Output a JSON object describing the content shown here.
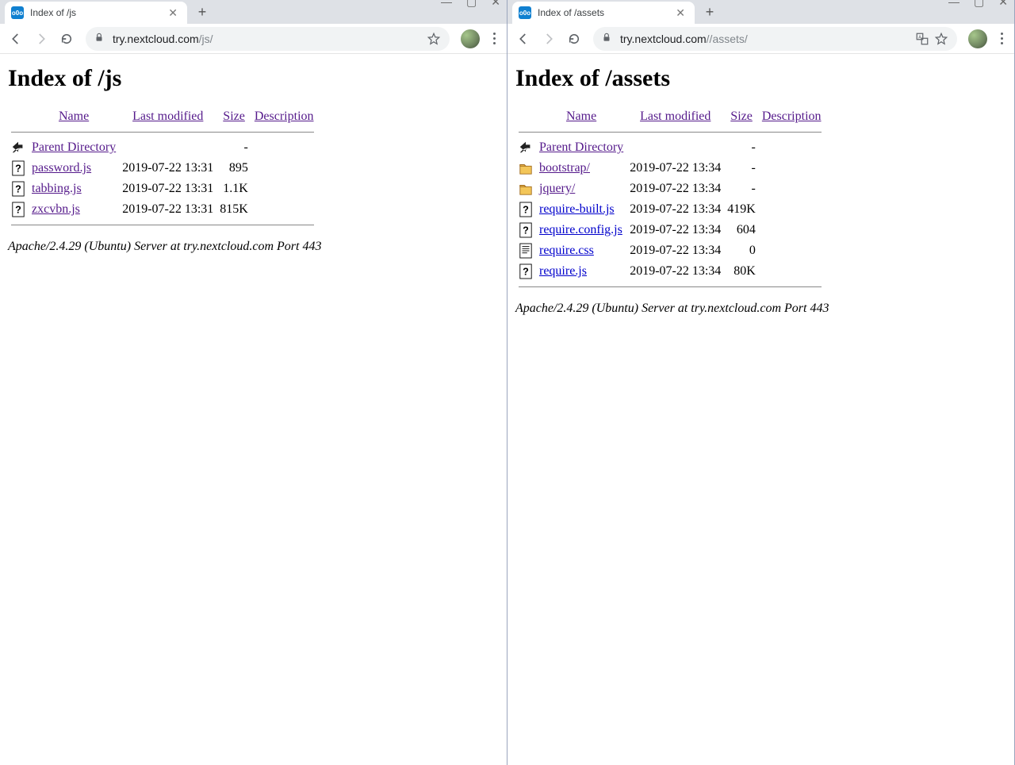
{
  "left": {
    "tab_title": "Index of /js",
    "url_host": "try.nextcloud.com",
    "url_path": "/js/",
    "heading": "Index of /js",
    "columns": {
      "name": "Name",
      "modified": "Last modified",
      "size": "Size",
      "desc": "Description"
    },
    "parent_label": "Parent Directory",
    "rows": [
      {
        "icon": "unknown",
        "name": "password.js",
        "modified": "2019-07-22 13:31",
        "size": "895",
        "visited": true
      },
      {
        "icon": "unknown",
        "name": "tabbing.js",
        "modified": "2019-07-22 13:31",
        "size": "1.1K",
        "visited": true
      },
      {
        "icon": "unknown",
        "name": "zxcvbn.js",
        "modified": "2019-07-22 13:31",
        "size": "815K",
        "visited": true
      }
    ],
    "footer": "Apache/2.4.29 (Ubuntu) Server at try.nextcloud.com Port 443"
  },
  "right": {
    "tab_title": "Index of /assets",
    "url_host": "try.nextcloud.com",
    "url_path": "//assets/",
    "heading": "Index of /assets",
    "columns": {
      "name": "Name",
      "modified": "Last modified",
      "size": "Size",
      "desc": "Description"
    },
    "parent_label": "Parent Directory",
    "rows": [
      {
        "icon": "folder",
        "name": "bootstrap/",
        "modified": "2019-07-22 13:34",
        "size": "-",
        "visited": true
      },
      {
        "icon": "folder",
        "name": "jquery/",
        "modified": "2019-07-22 13:34",
        "size": "-",
        "visited": true
      },
      {
        "icon": "unknown",
        "name": "require-built.js",
        "modified": "2019-07-22 13:34",
        "size": "419K",
        "visited": false
      },
      {
        "icon": "unknown",
        "name": "require.config.js",
        "modified": "2019-07-22 13:34",
        "size": "604",
        "visited": false
      },
      {
        "icon": "text",
        "name": "require.css",
        "modified": "2019-07-22 13:34",
        "size": "0",
        "visited": false
      },
      {
        "icon": "unknown",
        "name": "require.js",
        "modified": "2019-07-22 13:34",
        "size": "80K",
        "visited": false
      }
    ],
    "footer": "Apache/2.4.29 (Ubuntu) Server at try.nextcloud.com Port 443"
  }
}
